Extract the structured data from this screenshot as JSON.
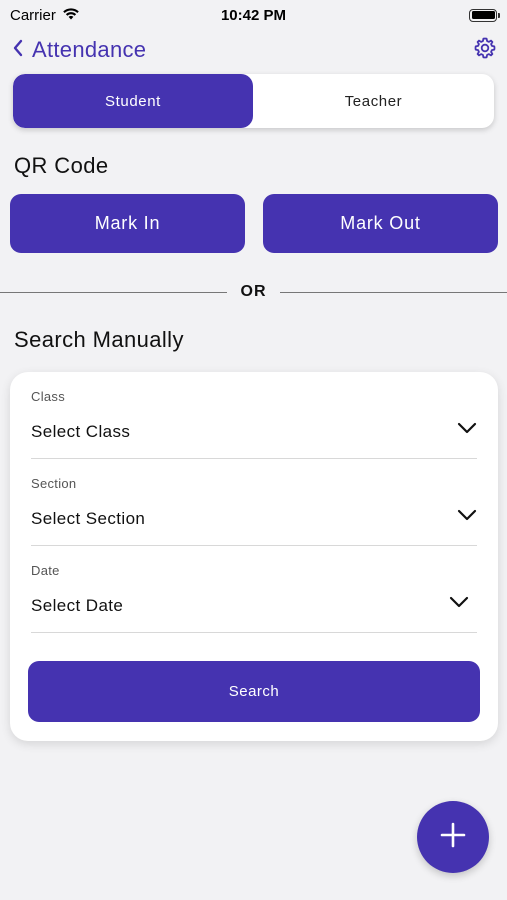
{
  "status_bar": {
    "carrier": "Carrier",
    "time": "10:42 PM",
    "battery_icon": "battery-icon",
    "wifi_icon": "wifi-icon"
  },
  "nav": {
    "title": "Attendance",
    "back_icon": "chevron-left-icon",
    "settings_icon": "gear-icon"
  },
  "segmented": {
    "tabs": [
      {
        "label": "Student",
        "active": true
      },
      {
        "label": "Teacher",
        "active": false
      }
    ]
  },
  "qr": {
    "title": "QR Code",
    "mark_in_label": "Mark In",
    "mark_out_label": "Mark Out"
  },
  "divider": {
    "label": "OR"
  },
  "manual": {
    "title": "Search Manually",
    "fields": [
      {
        "label": "Class",
        "value": "Select Class"
      },
      {
        "label": "Section",
        "value": "Select Section"
      },
      {
        "label": "Date",
        "value": "Select Date"
      }
    ],
    "search_label": "Search"
  },
  "fab": {
    "icon": "plus-icon"
  },
  "colors": {
    "accent": "#4533b0",
    "background": "#f2f2f4",
    "card": "#ffffff"
  }
}
